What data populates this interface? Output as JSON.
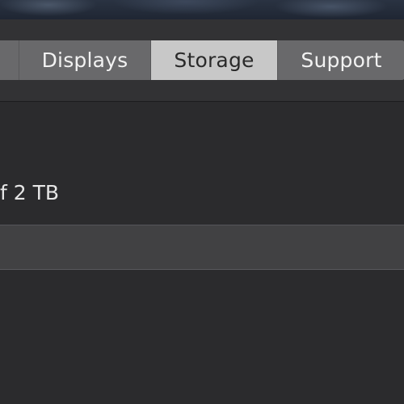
{
  "tabs": [
    {
      "label": "",
      "selected": false
    },
    {
      "label": "Displays",
      "selected": false
    },
    {
      "label": "Storage",
      "selected": true
    },
    {
      "label": "Support",
      "selected": false
    }
  ],
  "storage": {
    "summary_fragment": "f 2 TB"
  },
  "colors": {
    "window_bg": "#2b2b2d",
    "toolbar_bg": "#323234",
    "tab_bg": "#69696b",
    "tab_selected_bg": "#c8c8c8",
    "storage_bar_bg": "#414143"
  }
}
